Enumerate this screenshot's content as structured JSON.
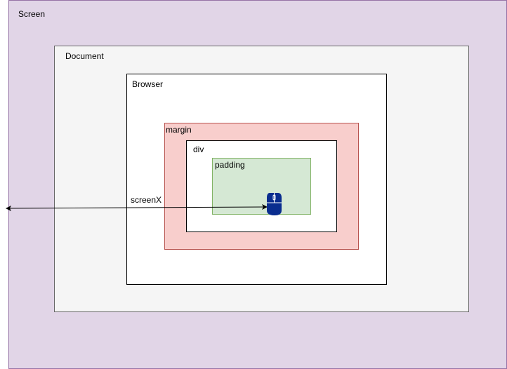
{
  "labels": {
    "screen": "Screen",
    "document": "Document",
    "browser": "Browser",
    "margin": "margin",
    "div": "div",
    "padding": "padding",
    "screenx": "screenX"
  },
  "colors": {
    "screen_fill": "#e1d5e7",
    "screen_stroke": "#9673a6",
    "document_fill": "#f5f5f5",
    "document_stroke": "#666666",
    "browser_fill": "#ffffff",
    "browser_stroke": "#000000",
    "margin_fill": "#f8cecc",
    "margin_stroke": "#b85450",
    "div_fill": "#ffffff",
    "div_stroke": "#000000",
    "padding_fill": "#d5e8d4",
    "padding_stroke": "#82b366",
    "mouse_fill": "#0a2d8f",
    "arrow_stroke": "#000000"
  },
  "icons": {
    "pointer": "mouse-icon"
  }
}
